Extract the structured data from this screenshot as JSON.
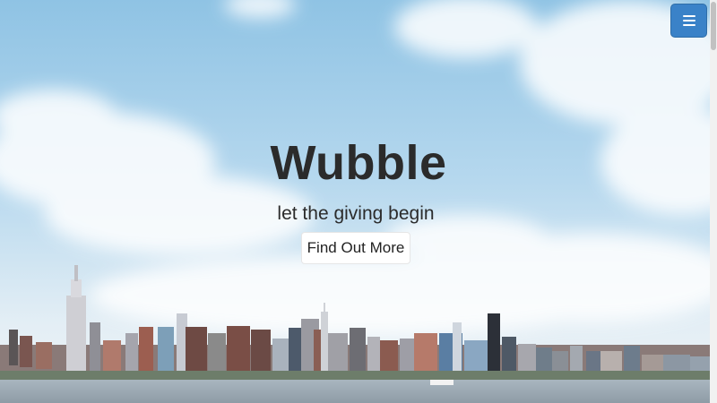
{
  "header": {
    "menu_icon": "hamburger-menu-icon",
    "accent_color": "#3a82c8"
  },
  "hero": {
    "title": "Wubble",
    "subtitle": "let the giving begin",
    "cta_label": "Find Out More"
  }
}
